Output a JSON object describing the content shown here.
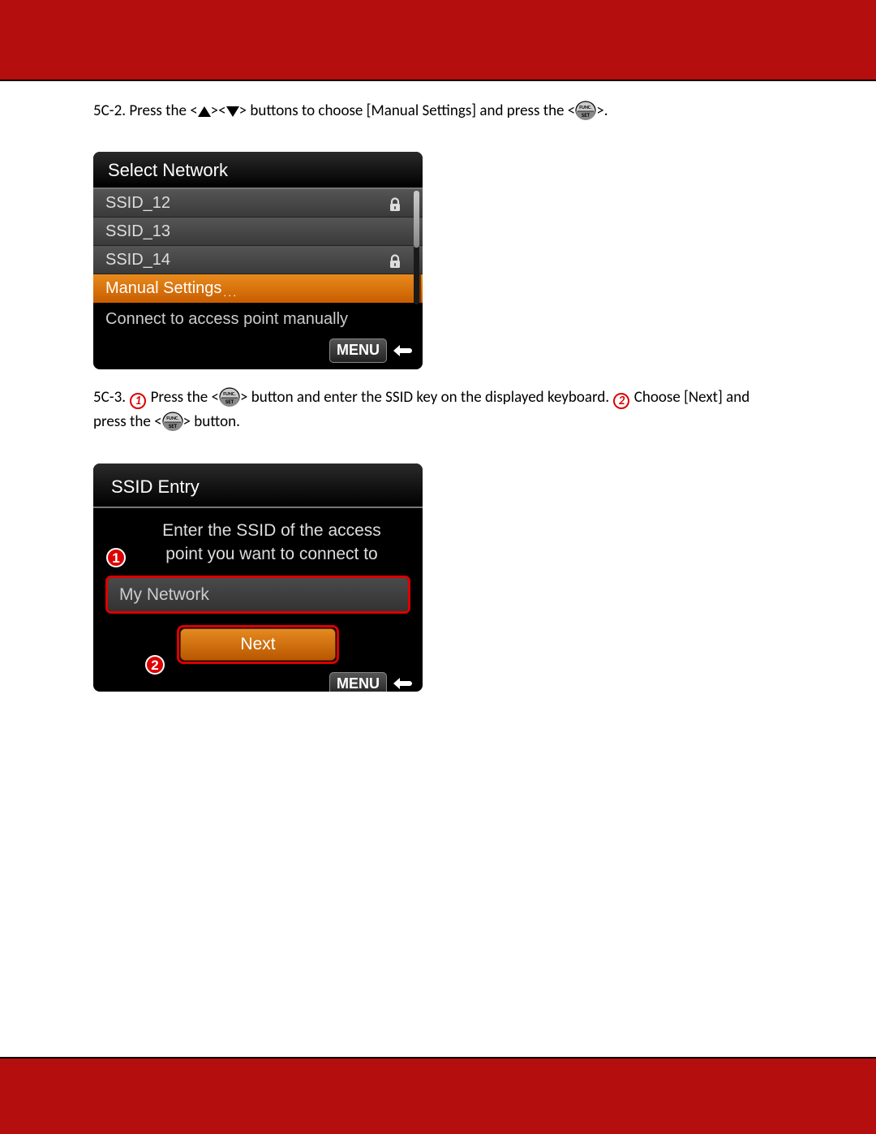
{
  "step1": {
    "num": "5C-2.",
    "part1": "Press the <",
    "part2": "><",
    "part3": "> buttons to choose [Manual Settings] and press the <",
    "part4": ">."
  },
  "screen1": {
    "title": "Select Network",
    "rows": [
      {
        "label": "SSID_12",
        "locked": true
      },
      {
        "label": "SSID_13",
        "locked": false
      },
      {
        "label": "SSID_14",
        "locked": true
      }
    ],
    "selected": "Manual Settings",
    "hint": "Connect to access point manually",
    "menu": "MENU"
  },
  "step2": {
    "num": "5C-3.",
    "m1": "1",
    "part1": "Press the <",
    "part2": "> button and enter the SSID key on the displayed keyboard.",
    "m2": "2",
    "part3": "Choose [Next] and press the <",
    "part4": "> button."
  },
  "screen2": {
    "title": "SSID Entry",
    "msgA": "Enter the SSID of the access",
    "msgB": "point you want to connect to",
    "field": "My Network",
    "next": "Next",
    "menu": "MENU",
    "c1": "1",
    "c2": "2"
  }
}
